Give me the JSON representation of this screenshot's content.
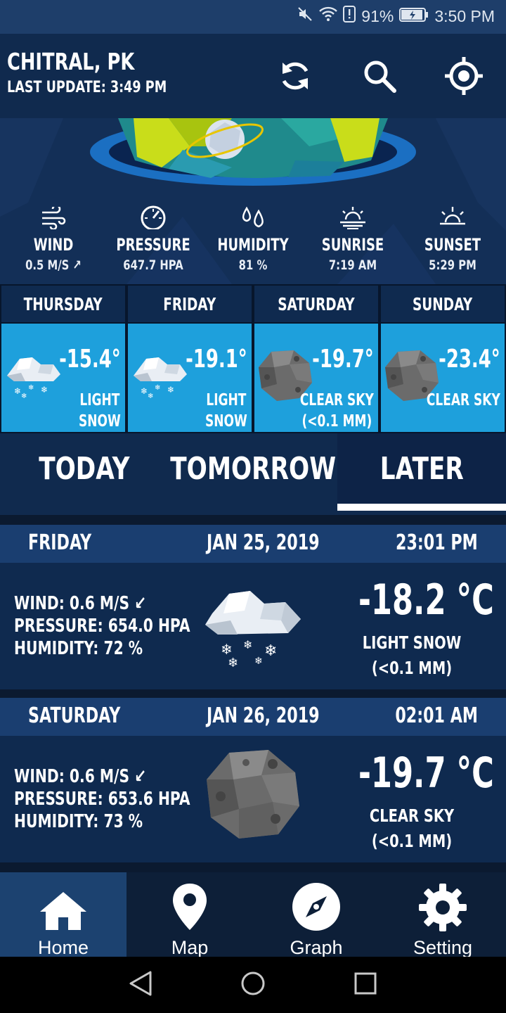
{
  "status_bar": {
    "battery": "91%",
    "time": "3:50 PM"
  },
  "header": {
    "city": "CHITRAL, PK",
    "last_update": "LAST UPDATE: 3:49 PM"
  },
  "metrics": [
    {
      "icon": "wind-icon",
      "label": "WIND",
      "value": "0.5 M/S ↗"
    },
    {
      "icon": "gauge-icon",
      "label": "PRESSURE",
      "value": "647.7 HPA"
    },
    {
      "icon": "droplets-icon",
      "label": "HUMIDITY",
      "value": "81 %"
    },
    {
      "icon": "sunrise-icon",
      "label": "SUNRISE",
      "value": "7:19 AM"
    },
    {
      "icon": "sunset-icon",
      "label": "SUNSET",
      "value": "5:29 PM"
    }
  ],
  "daily": [
    {
      "day": "THURSDAY",
      "temp": "-15.4°",
      "desc1": "LIGHT",
      "desc2": "SNOW",
      "icon": "snow-cloud-icon"
    },
    {
      "day": "FRIDAY",
      "temp": "-19.1°",
      "desc1": "LIGHT",
      "desc2": "SNOW",
      "icon": "snow-cloud-icon"
    },
    {
      "day": "SATURDAY",
      "temp": "-19.7°",
      "desc1": "CLEAR SKY",
      "desc2": "(<0.1 MM)",
      "icon": "moon-icon"
    },
    {
      "day": "SUNDAY",
      "temp": "-23.4°",
      "desc1": "CLEAR SKY",
      "desc2": "",
      "icon": "moon-icon"
    }
  ],
  "tabs": [
    {
      "label": "TODAY",
      "active": false
    },
    {
      "label": "TOMORROW",
      "active": false
    },
    {
      "label": "LATER",
      "active": true
    }
  ],
  "forecast": [
    {
      "day": "FRIDAY",
      "date": "JAN 25, 2019",
      "time": "23:01 PM",
      "wind": "WIND: 0.6 M/S ↙",
      "pressure": "PRESSURE: 654.0 HPA",
      "humidity": "HUMIDITY: 72 %",
      "temp": "-18.2 °C",
      "cond1": "LIGHT SNOW",
      "cond2": "(<0.1 MM)",
      "icon": "snow-cloud-icon"
    },
    {
      "day": "SATURDAY",
      "date": "JAN 26, 2019",
      "time": "02:01 AM",
      "wind": "WIND: 0.6 M/S ↙",
      "pressure": "PRESSURE: 653.6 HPA",
      "humidity": "HUMIDITY: 73 %",
      "temp": "-19.7 °C",
      "cond1": "CLEAR SKY",
      "cond2": "(<0.1 MM)",
      "icon": "moon-icon"
    }
  ],
  "nav": [
    {
      "label": "Home",
      "icon": "home-icon",
      "active": true
    },
    {
      "label": "Map",
      "icon": "map-pin-icon",
      "active": false
    },
    {
      "label": "Graph",
      "icon": "compass-icon",
      "active": false
    },
    {
      "label": "Setting",
      "icon": "gear-icon",
      "active": false
    }
  ],
  "colors": {
    "accent": "#1ea0dc",
    "header": "#102a4e",
    "card": "#0f2a4f",
    "card_header": "#1a3e70"
  }
}
